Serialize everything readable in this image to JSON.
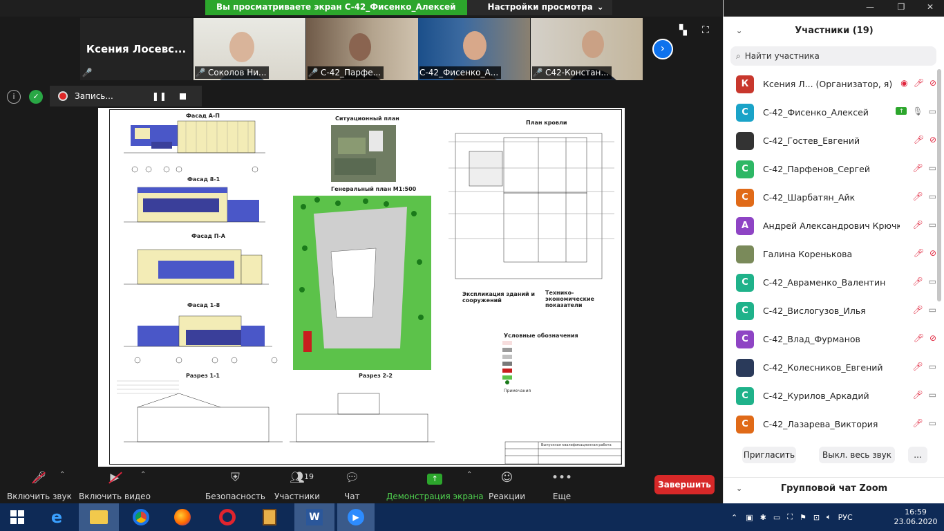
{
  "share_banner": {
    "text": "Вы просматриваете экран С-42_Фисенко_Алексей",
    "options_label": "Настройки просмотра"
  },
  "video_strip": {
    "tiles": [
      {
        "name": "Ксения  Лосевс..."
      },
      {
        "name": "Соколов Ни..."
      },
      {
        "name": "С-42_Парфе..."
      },
      {
        "name": "С-42_Фисенко_А..."
      },
      {
        "name": "С42-Констан..."
      }
    ]
  },
  "recording": {
    "label": "Запись...",
    "pause_glyph": "❚❚"
  },
  "drawing": {
    "facade_ap": "Фасад А-П",
    "facade_81": "Фасад 8-1",
    "facade_pa": "Фасад П-А",
    "facade_18": "Фасад 1-8",
    "situation_plan": "Ситуационный план",
    "general_plan": "Генеральный план М1:500",
    "roof_plan": "План кровли",
    "section_11": "Разрез 1-1",
    "section_22": "Разрез 2-2",
    "explication": "Экспликация зданий и сооружений",
    "tep": "Технико-экономические показатели",
    "legend": "Условные обозначения",
    "notes": "Примечания",
    "stamp": "Выпускная квалификационная работа"
  },
  "toolbar": {
    "audio": "Включить звук",
    "video": "Включить видео",
    "security": "Безопасность",
    "participants": "Участники",
    "participants_count": "19",
    "chat": "Чат",
    "share": "Демонстрация экрана",
    "reactions": "Реакции",
    "more": "Еще",
    "end": "Завершить"
  },
  "panel": {
    "title": "Участники (19)",
    "search_placeholder": "Найти участника",
    "participants": [
      {
        "initial": "К",
        "color": "#c8372d",
        "name": "Ксения Л...  (Организатор, я)",
        "rec": true,
        "share": false,
        "mic_on": false,
        "cam_on": false
      },
      {
        "initial": "С",
        "color": "#1aa3c8",
        "name": "С-42_Фисенко_Алексей",
        "rec": false,
        "share": true,
        "mic_on": true,
        "cam_on": true
      },
      {
        "initial": "",
        "color": "#333333",
        "name": "С-42_Гостев_Евгений",
        "rec": false,
        "share": false,
        "mic_on": false,
        "cam_on": false
      },
      {
        "initial": "С",
        "color": "#2db765",
        "name": "С-42_Парфенов_Сергей",
        "rec": false,
        "share": false,
        "mic_on": false,
        "cam_on": true
      },
      {
        "initial": "С",
        "color": "#e06a18",
        "name": "С-42_Шарбатян_Айк",
        "rec": false,
        "share": false,
        "mic_on": false,
        "cam_on": true
      },
      {
        "initial": "А",
        "color": "#8e44c4",
        "name": "Андрей Александрович Крючк...",
        "rec": false,
        "share": false,
        "mic_on": false,
        "cam_on": true
      },
      {
        "initial": "",
        "color": "#7a8a5a",
        "name": "Галина Коренькова",
        "rec": false,
        "share": false,
        "mic_on": false,
        "cam_on": false
      },
      {
        "initial": "С",
        "color": "#1fb28a",
        "name": "С-42_Авраменко_Валентин",
        "rec": false,
        "share": false,
        "mic_on": false,
        "cam_on": true
      },
      {
        "initial": "С",
        "color": "#1fb28a",
        "name": "С-42_Вислогузов_Илья",
        "rec": false,
        "share": false,
        "mic_on": false,
        "cam_on": true
      },
      {
        "initial": "С",
        "color": "#8e44c4",
        "name": "С-42_Влад_Фурманов",
        "rec": false,
        "share": false,
        "mic_on": false,
        "cam_on": false
      },
      {
        "initial": "",
        "color": "#2a3a5a",
        "name": "С-42_Колесников_Евгений",
        "rec": false,
        "share": false,
        "mic_on": false,
        "cam_on": true
      },
      {
        "initial": "С",
        "color": "#1fb28a",
        "name": "С-42_Курилов_Аркадий",
        "rec": false,
        "share": false,
        "mic_on": false,
        "cam_on": true
      },
      {
        "initial": "С",
        "color": "#e06a18",
        "name": "С-42_Лазарева_Виктория",
        "rec": false,
        "share": false,
        "mic_on": false,
        "cam_on": true
      }
    ],
    "invite": "Пригласить",
    "mute_all": "Выкл. весь звук",
    "more": "...",
    "chat_title": "Групповой чат Zoom"
  },
  "taskbar": {
    "lang": "РУС",
    "time": "16:59",
    "date": "23.06.2020"
  }
}
